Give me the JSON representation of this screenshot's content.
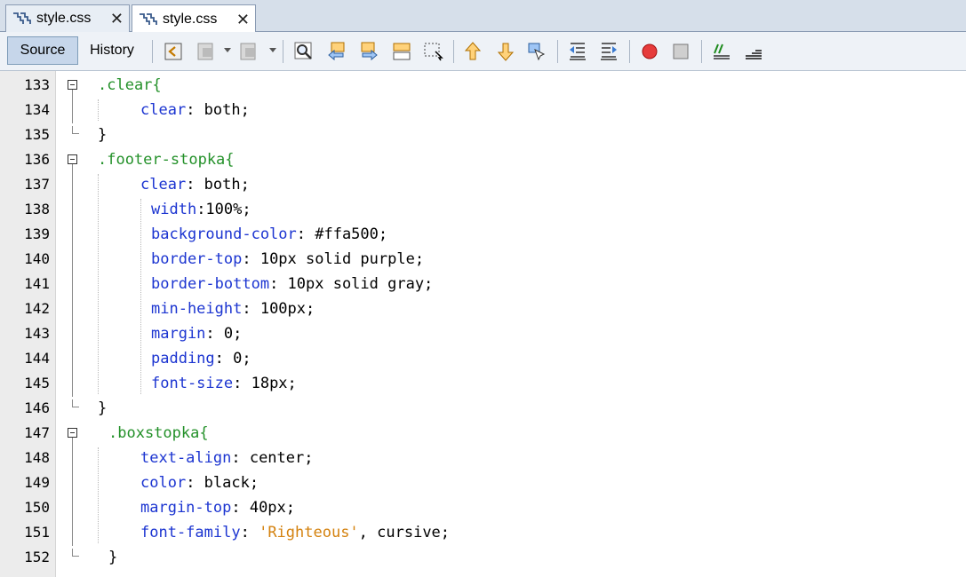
{
  "tabs": [
    {
      "label": "style.css",
      "close": "✕"
    },
    {
      "label": "style.css",
      "close": "✕"
    }
  ],
  "toolbar": {
    "source_label": "Source",
    "history_label": "History"
  },
  "editor": {
    "lines": [
      {
        "num": "133",
        "parts": [
          {
            "t": ".clear{",
            "c": "sel"
          }
        ],
        "indent": 0
      },
      {
        "num": "134",
        "parts": [
          {
            "t": "clear",
            "c": "prop"
          },
          {
            "t": ": both;",
            "c": "val"
          }
        ],
        "indent": 1
      },
      {
        "num": "135",
        "parts": [
          {
            "t": "}",
            "c": "val"
          }
        ],
        "indent": 0
      },
      {
        "num": "136",
        "parts": [
          {
            "t": ".footer-stopka{",
            "c": "sel"
          }
        ],
        "indent": 0
      },
      {
        "num": "137",
        "parts": [
          {
            "t": "clear",
            "c": "prop"
          },
          {
            "t": ": both;",
            "c": "val"
          }
        ],
        "indent": 1
      },
      {
        "num": "138",
        "parts": [
          {
            "t": "width",
            "c": "prop"
          },
          {
            "t": ":100%;",
            "c": "val"
          }
        ],
        "indent": 2
      },
      {
        "num": "139",
        "parts": [
          {
            "t": "background-color",
            "c": "prop"
          },
          {
            "t": ": #ffa500;",
            "c": "val"
          }
        ],
        "indent": 2
      },
      {
        "num": "140",
        "parts": [
          {
            "t": "border-top",
            "c": "prop"
          },
          {
            "t": ": 10px solid purple;",
            "c": "val"
          }
        ],
        "indent": 2
      },
      {
        "num": "141",
        "parts": [
          {
            "t": "border-bottom",
            "c": "prop"
          },
          {
            "t": ": 10px solid gray;",
            "c": "val"
          }
        ],
        "indent": 2
      },
      {
        "num": "142",
        "parts": [
          {
            "t": "min-height",
            "c": "prop"
          },
          {
            "t": ": 100px;",
            "c": "val"
          }
        ],
        "indent": 2
      },
      {
        "num": "143",
        "parts": [
          {
            "t": "margin",
            "c": "prop"
          },
          {
            "t": ": 0;",
            "c": "val"
          }
        ],
        "indent": 2
      },
      {
        "num": "144",
        "parts": [
          {
            "t": "padding",
            "c": "prop"
          },
          {
            "t": ": 0;",
            "c": "val"
          }
        ],
        "indent": 2
      },
      {
        "num": "145",
        "parts": [
          {
            "t": "font-size",
            "c": "prop"
          },
          {
            "t": ": 18px;",
            "c": "val"
          }
        ],
        "indent": 2
      },
      {
        "num": "146",
        "parts": [
          {
            "t": "}",
            "c": "val"
          }
        ],
        "indent": 0
      },
      {
        "num": "147",
        "parts": [
          {
            "t": ".boxstopka{",
            "c": "sel"
          }
        ],
        "indent": 3
      },
      {
        "num": "148",
        "parts": [
          {
            "t": "text-align",
            "c": "prop"
          },
          {
            "t": ": center;",
            "c": "val"
          }
        ],
        "indent": 1
      },
      {
        "num": "149",
        "parts": [
          {
            "t": "color",
            "c": "prop"
          },
          {
            "t": ": black;",
            "c": "val"
          }
        ],
        "indent": 1
      },
      {
        "num": "150",
        "parts": [
          {
            "t": "margin-top",
            "c": "prop"
          },
          {
            "t": ": 40px;",
            "c": "val"
          }
        ],
        "indent": 1
      },
      {
        "num": "151",
        "parts": [
          {
            "t": "font-family",
            "c": "prop"
          },
          {
            "t": ": ",
            "c": "val"
          },
          {
            "t": "'Righteous'",
            "c": "str"
          },
          {
            "t": ", cursive;",
            "c": "val"
          }
        ],
        "indent": 1
      },
      {
        "num": "152",
        "parts": [
          {
            "t": "}",
            "c": "val"
          }
        ],
        "indent": 3
      }
    ]
  },
  "icons": [
    "go-back-icon",
    "go-forward-icon",
    "find-icon",
    "find-previous-icon",
    "find-next-icon",
    "find-selection-icon",
    "toggle-highlight-icon",
    "previous-bookmark-icon",
    "next-bookmark-icon",
    "toggle-bookmark-icon",
    "shift-left-icon",
    "shift-right-icon",
    "start-macro-icon",
    "stop-macro-icon",
    "comment-icon",
    "uncomment-icon"
  ]
}
